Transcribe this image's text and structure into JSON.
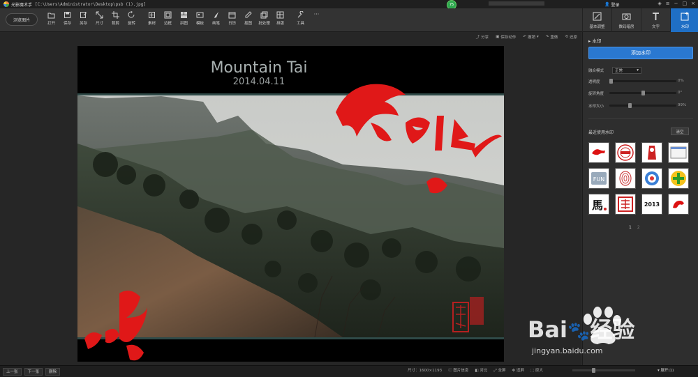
{
  "titlebar": {
    "app_name": "光影魔术手",
    "file_path": "[C:\\Users\\Administrator\\Desktop\\psb (1).jpg]",
    "score": "75",
    "login": "登录"
  },
  "toolbar": {
    "browse_label": "浏览图片",
    "tools": [
      {
        "name": "open",
        "label": "打开",
        "icon": "open-icon"
      },
      {
        "name": "save",
        "label": "保存",
        "icon": "save-icon"
      },
      {
        "name": "save-as",
        "label": "另存",
        "icon": "save-as-icon"
      },
      {
        "name": "size",
        "label": "尺寸",
        "icon": "resize-icon"
      },
      {
        "name": "crop",
        "label": "裁剪",
        "icon": "crop-icon"
      },
      {
        "name": "rotate",
        "label": "旋转",
        "icon": "rotate-icon"
      },
      {
        "name": "material",
        "label": "素材",
        "icon": "material-icon"
      },
      {
        "name": "border",
        "label": "边框",
        "icon": "border-icon"
      },
      {
        "name": "collage",
        "label": "拼图",
        "icon": "collage-icon"
      },
      {
        "name": "template",
        "label": "模板",
        "icon": "template-icon"
      },
      {
        "name": "brush",
        "label": "画笔",
        "icon": "brush-icon"
      },
      {
        "name": "calendar",
        "label": "日历",
        "icon": "calendar-icon"
      },
      {
        "name": "pick",
        "label": "抠图",
        "icon": "eyedropper-icon"
      },
      {
        "name": "batch",
        "label": "批处理",
        "icon": "batch-icon"
      },
      {
        "name": "layout",
        "label": "排版",
        "icon": "layout-icon"
      },
      {
        "name": "tools",
        "label": "工具",
        "icon": "wrench-icon"
      }
    ],
    "more": "···",
    "tabs": [
      {
        "name": "basic",
        "label": "基本调整",
        "icon": "adjust-icon"
      },
      {
        "name": "digital",
        "label": "数码暗房",
        "icon": "camera-icon"
      },
      {
        "name": "text",
        "label": "文字",
        "icon": "text-icon"
      },
      {
        "name": "watermark",
        "label": "水印",
        "icon": "watermark-icon",
        "active": true
      }
    ]
  },
  "subbar": {
    "share": "分享",
    "save_action": "保存动作",
    "undo": "撤销",
    "redo": "重做",
    "restore": "还原"
  },
  "photo": {
    "title": "Mountain Tai",
    "date": "2014.04.11"
  },
  "panel": {
    "title": "水印",
    "add_button": "添加水印",
    "blend_label": "融合模式",
    "blend_value": "正常",
    "opacity_label": "透明度",
    "opacity_value": "0%",
    "opacity_level": 0,
    "rotation_label": "旋转角度",
    "rotation_value": "0°",
    "rotation_level": 0.5,
    "size_label": "水印大小",
    "size_value": "99%",
    "size_level": 0.3,
    "recent_title": "最近使用水印",
    "clear_button": "清空",
    "page_current": "1",
    "page_next": "2",
    "thumbnails": [
      "horse-2014",
      "red-seal",
      "red-figure",
      "blank-card",
      "fun-logo",
      "fingerprint",
      "swirl-logo",
      "plus-badge",
      "ma-character",
      "seal-stamp",
      "2013-logo",
      "red-horse"
    ]
  },
  "status": {
    "prev": "上一张",
    "next": "下一张",
    "delete": "删除",
    "size_info": "尺寸：1600×1193",
    "info": "图片信息",
    "compare": "对比",
    "fullscreen": "全屏",
    "fit": "适屏",
    "original": "原大",
    "expand": "展开(1)"
  },
  "watermark_logo": {
    "brand": "Bai",
    "brand_suffix": "经验",
    "url": "jingyan.baidu.com"
  }
}
